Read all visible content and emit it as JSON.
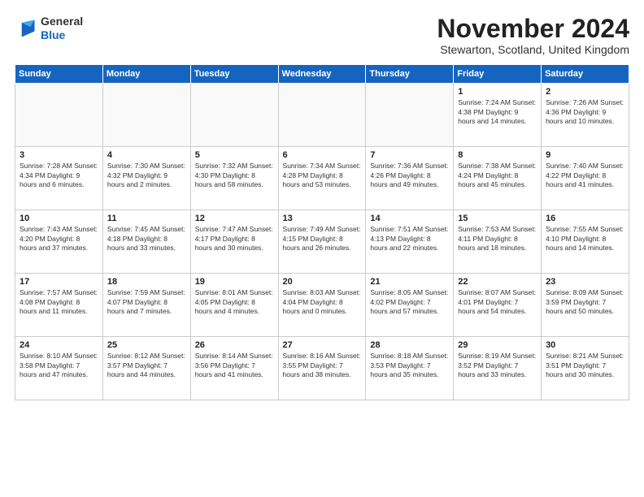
{
  "logo": {
    "general": "General",
    "blue": "Blue"
  },
  "header": {
    "month": "November 2024",
    "location": "Stewarton, Scotland, United Kingdom"
  },
  "weekdays": [
    "Sunday",
    "Monday",
    "Tuesday",
    "Wednesday",
    "Thursday",
    "Friday",
    "Saturday"
  ],
  "weeks": [
    [
      {
        "day": "",
        "info": ""
      },
      {
        "day": "",
        "info": ""
      },
      {
        "day": "",
        "info": ""
      },
      {
        "day": "",
        "info": ""
      },
      {
        "day": "",
        "info": ""
      },
      {
        "day": "1",
        "info": "Sunrise: 7:24 AM\nSunset: 4:38 PM\nDaylight: 9 hours and 14 minutes."
      },
      {
        "day": "2",
        "info": "Sunrise: 7:26 AM\nSunset: 4:36 PM\nDaylight: 9 hours and 10 minutes."
      }
    ],
    [
      {
        "day": "3",
        "info": "Sunrise: 7:28 AM\nSunset: 4:34 PM\nDaylight: 9 hours and 6 minutes."
      },
      {
        "day": "4",
        "info": "Sunrise: 7:30 AM\nSunset: 4:32 PM\nDaylight: 9 hours and 2 minutes."
      },
      {
        "day": "5",
        "info": "Sunrise: 7:32 AM\nSunset: 4:30 PM\nDaylight: 8 hours and 58 minutes."
      },
      {
        "day": "6",
        "info": "Sunrise: 7:34 AM\nSunset: 4:28 PM\nDaylight: 8 hours and 53 minutes."
      },
      {
        "day": "7",
        "info": "Sunrise: 7:36 AM\nSunset: 4:26 PM\nDaylight: 8 hours and 49 minutes."
      },
      {
        "day": "8",
        "info": "Sunrise: 7:38 AM\nSunset: 4:24 PM\nDaylight: 8 hours and 45 minutes."
      },
      {
        "day": "9",
        "info": "Sunrise: 7:40 AM\nSunset: 4:22 PM\nDaylight: 8 hours and 41 minutes."
      }
    ],
    [
      {
        "day": "10",
        "info": "Sunrise: 7:43 AM\nSunset: 4:20 PM\nDaylight: 8 hours and 37 minutes."
      },
      {
        "day": "11",
        "info": "Sunrise: 7:45 AM\nSunset: 4:18 PM\nDaylight: 8 hours and 33 minutes."
      },
      {
        "day": "12",
        "info": "Sunrise: 7:47 AM\nSunset: 4:17 PM\nDaylight: 8 hours and 30 minutes."
      },
      {
        "day": "13",
        "info": "Sunrise: 7:49 AM\nSunset: 4:15 PM\nDaylight: 8 hours and 26 minutes."
      },
      {
        "day": "14",
        "info": "Sunrise: 7:51 AM\nSunset: 4:13 PM\nDaylight: 8 hours and 22 minutes."
      },
      {
        "day": "15",
        "info": "Sunrise: 7:53 AM\nSunset: 4:11 PM\nDaylight: 8 hours and 18 minutes."
      },
      {
        "day": "16",
        "info": "Sunrise: 7:55 AM\nSunset: 4:10 PM\nDaylight: 8 hours and 14 minutes."
      }
    ],
    [
      {
        "day": "17",
        "info": "Sunrise: 7:57 AM\nSunset: 4:08 PM\nDaylight: 8 hours and 11 minutes."
      },
      {
        "day": "18",
        "info": "Sunrise: 7:59 AM\nSunset: 4:07 PM\nDaylight: 8 hours and 7 minutes."
      },
      {
        "day": "19",
        "info": "Sunrise: 8:01 AM\nSunset: 4:05 PM\nDaylight: 8 hours and 4 minutes."
      },
      {
        "day": "20",
        "info": "Sunrise: 8:03 AM\nSunset: 4:04 PM\nDaylight: 8 hours and 0 minutes."
      },
      {
        "day": "21",
        "info": "Sunrise: 8:05 AM\nSunset: 4:02 PM\nDaylight: 7 hours and 57 minutes."
      },
      {
        "day": "22",
        "info": "Sunrise: 8:07 AM\nSunset: 4:01 PM\nDaylight: 7 hours and 54 minutes."
      },
      {
        "day": "23",
        "info": "Sunrise: 8:09 AM\nSunset: 3:59 PM\nDaylight: 7 hours and 50 minutes."
      }
    ],
    [
      {
        "day": "24",
        "info": "Sunrise: 8:10 AM\nSunset: 3:58 PM\nDaylight: 7 hours and 47 minutes."
      },
      {
        "day": "25",
        "info": "Sunrise: 8:12 AM\nSunset: 3:57 PM\nDaylight: 7 hours and 44 minutes."
      },
      {
        "day": "26",
        "info": "Sunrise: 8:14 AM\nSunset: 3:56 PM\nDaylight: 7 hours and 41 minutes."
      },
      {
        "day": "27",
        "info": "Sunrise: 8:16 AM\nSunset: 3:55 PM\nDaylight: 7 hours and 38 minutes."
      },
      {
        "day": "28",
        "info": "Sunrise: 8:18 AM\nSunset: 3:53 PM\nDaylight: 7 hours and 35 minutes."
      },
      {
        "day": "29",
        "info": "Sunrise: 8:19 AM\nSunset: 3:52 PM\nDaylight: 7 hours and 33 minutes."
      },
      {
        "day": "30",
        "info": "Sunrise: 8:21 AM\nSunset: 3:51 PM\nDaylight: 7 hours and 30 minutes."
      }
    ]
  ]
}
